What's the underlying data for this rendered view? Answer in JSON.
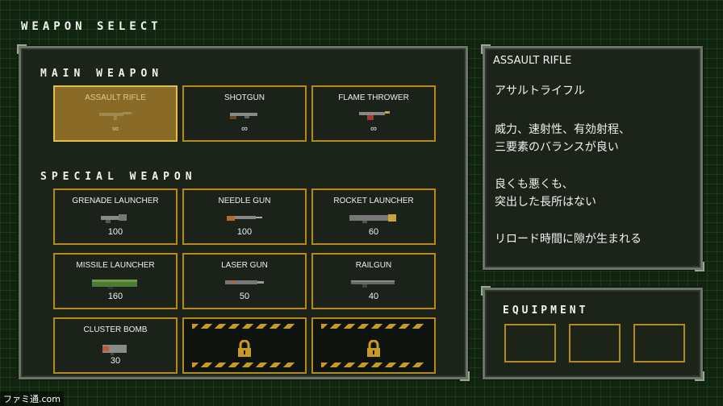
{
  "screen_title": "WEAPON SELECT",
  "main_section_label": "MAIN WEAPON",
  "special_section_label": "SPECIAL WEAPON",
  "main_weapons": [
    {
      "name": "ASSAULT RIFLE",
      "ammo": "∞",
      "selected": true
    },
    {
      "name": "SHOTGUN",
      "ammo": "∞",
      "selected": false
    },
    {
      "name": "FLAME THROWER",
      "ammo": "∞",
      "selected": false
    }
  ],
  "special_weapons": [
    {
      "name": "GRENADE LAUNCHER",
      "ammo": "100"
    },
    {
      "name": "NEEDLE GUN",
      "ammo": "100"
    },
    {
      "name": "ROCKET LAUNCHER",
      "ammo": "60"
    },
    {
      "name": "MISSILE LAUNCHER",
      "ammo": "160"
    },
    {
      "name": "LASER GUN",
      "ammo": "50"
    },
    {
      "name": "RAILGUN",
      "ammo": "40"
    },
    {
      "name": "CLUSTER BOMB",
      "ammo": "30"
    }
  ],
  "locked_slot_count": 2,
  "info": {
    "title": "ASSAULT RIFLE",
    "jp_name": "アサルトライフル",
    "desc1_l1": "威力、速射性、有効射程、",
    "desc1_l2": "三要素のバランスが良い",
    "desc2_l1": "良くも悪くも、",
    "desc2_l2": "突出した長所はない",
    "desc3": "リロード時間に隙が生まれる"
  },
  "equipment_label": "EQUIPMENT",
  "watermark": "ファミ通.com",
  "colors": {
    "slot_border": "#b58a1c",
    "selected_bg": "#8a6a27",
    "background": "#10240f"
  }
}
